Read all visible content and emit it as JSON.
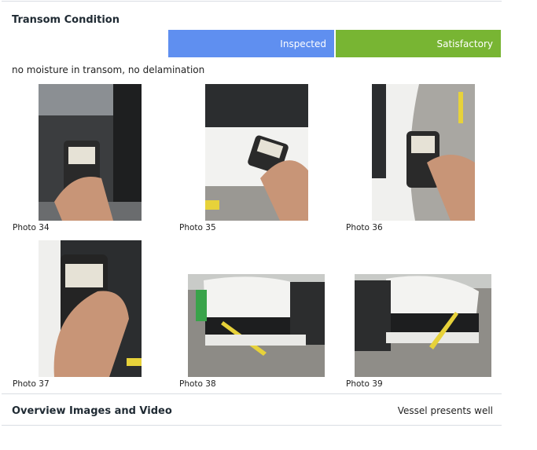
{
  "section": {
    "title": "Transom Condition",
    "status_inspected": "Inspected",
    "status_result": "Satisfactory",
    "note": "no moisture in transom, no delamination",
    "colors": {
      "inspected": "#5f8ff0",
      "satisfactory": "#78b533"
    }
  },
  "photos": [
    {
      "caption": "Photo 34",
      "icon": "moisture-meter-photo"
    },
    {
      "caption": "Photo 35",
      "icon": "moisture-meter-photo"
    },
    {
      "caption": "Photo 36",
      "icon": "moisture-meter-photo"
    },
    {
      "caption": "Photo 37",
      "icon": "moisture-meter-photo"
    },
    {
      "caption": "Photo 38",
      "icon": "boat-stern-photo"
    },
    {
      "caption": "Photo 39",
      "icon": "boat-stern-photo"
    }
  ],
  "overview": {
    "title": "Overview Images and Video",
    "value": "Vessel presents well"
  }
}
